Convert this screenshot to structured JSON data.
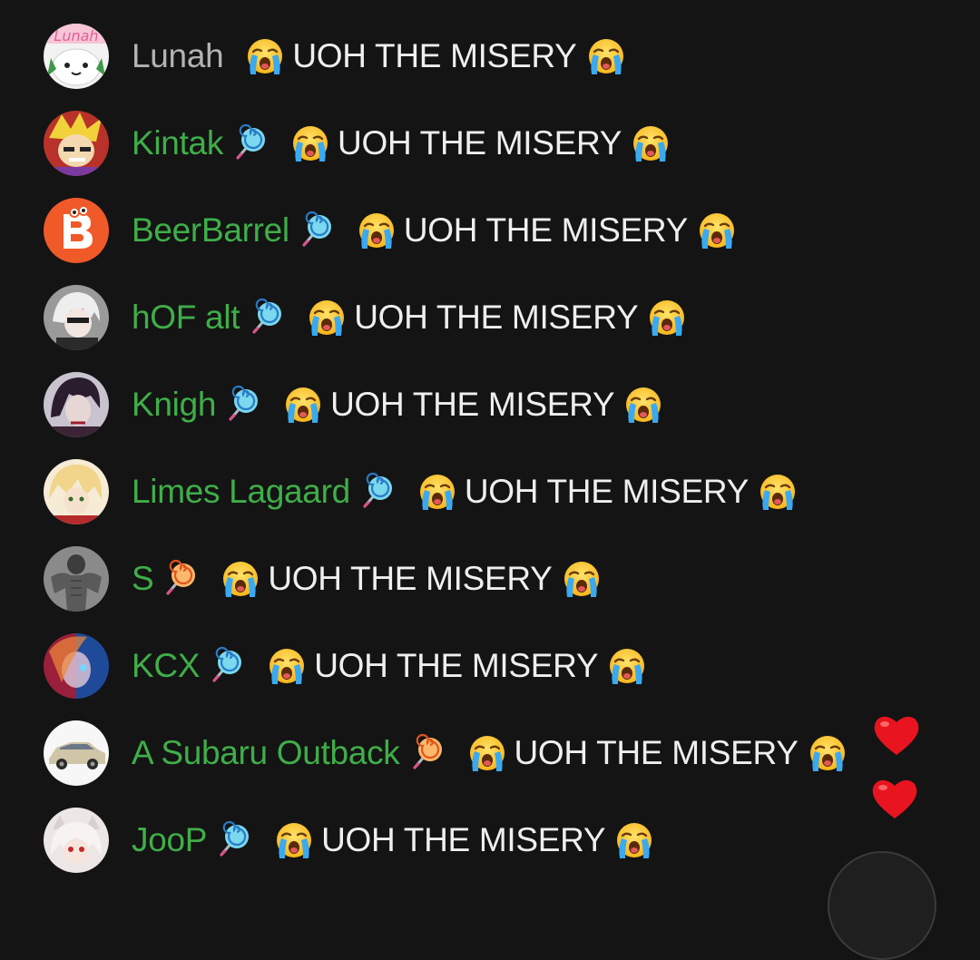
{
  "chat": {
    "messages": [
      {
        "author": "Lunah",
        "badge": null,
        "text": "UOH THE MISERY",
        "name_style": "plain",
        "avatar": {
          "icon": "white-cat-avatar",
          "bg": "#f1f1f1",
          "label": "Lunah"
        }
      },
      {
        "author": "Kintak",
        "badge": "lollipop-blue",
        "text": "UOH THE MISERY",
        "name_style": "member",
        "avatar": {
          "icon": "yellow-hair-character-avatar",
          "bg": "#c0392b"
        }
      },
      {
        "author": "BeerBarrel",
        "badge": "lollipop-blue",
        "text": "UOH THE MISERY",
        "name_style": "member",
        "avatar": {
          "icon": "orange-b-logo-avatar",
          "bg": "#f05a28"
        }
      },
      {
        "author": "hOF alt",
        "badge": "lollipop-blue",
        "text": "UOH THE MISERY",
        "name_style": "member",
        "avatar": {
          "icon": "white-hair-character-avatar",
          "bg": "#8e8e8e"
        }
      },
      {
        "author": "Knigh",
        "badge": "lollipop-blue",
        "text": "UOH THE MISERY",
        "name_style": "member",
        "avatar": {
          "icon": "dark-hair-character-avatar",
          "bg": "#5a4a5a"
        }
      },
      {
        "author": "Limes Lagaard",
        "badge": "lollipop-blue",
        "text": "UOH THE MISERY",
        "name_style": "member",
        "avatar": {
          "icon": "blonde-character-avatar",
          "bg": "#efe3c5"
        }
      },
      {
        "author": "S",
        "badge": "lollipop-orange",
        "text": "UOH THE MISERY",
        "name_style": "member",
        "avatar": {
          "icon": "muscular-figure-avatar",
          "bg": "#7b7b7b"
        }
      },
      {
        "author": "KCX",
        "badge": "lollipop-blue",
        "text": "UOH THE MISERY",
        "name_style": "member",
        "avatar": {
          "icon": "blue-red-portrait-avatar",
          "bg": "#3b2d5e"
        }
      },
      {
        "author": "A Subaru Outback",
        "badge": "lollipop-orange",
        "text": "UOH THE MISERY",
        "name_style": "member",
        "avatar": {
          "icon": "car-avatar",
          "bg": "#f5f5f5"
        }
      },
      {
        "author": "JooP",
        "badge": "lollipop-blue",
        "text": "UOH THE MISERY",
        "name_style": "member",
        "avatar": {
          "icon": "white-hair-anime-avatar",
          "bg": "#e8e4e2"
        }
      }
    ],
    "emoji": "loudly-crying-face-emoji",
    "reaction": "red-heart-icon"
  },
  "colors": {
    "background": "#141414",
    "member_name": "#3fae49",
    "plain_name": "#b3b3b3",
    "message_text": "#efefef",
    "heart": "#e8141f"
  }
}
